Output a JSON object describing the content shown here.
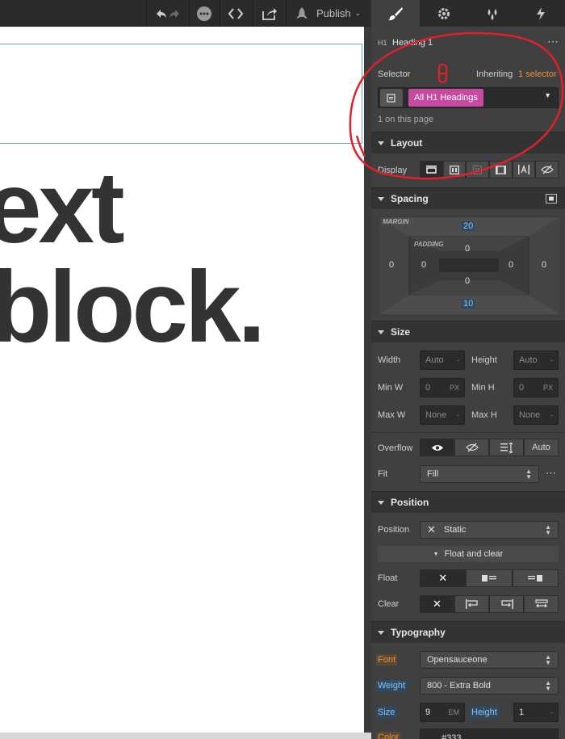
{
  "toolbar": {
    "publish_label": "Publish"
  },
  "canvas": {
    "line1": "ext",
    "line2": "block."
  },
  "panel_tabs": [
    "style",
    "settings",
    "interactions",
    "lightning"
  ],
  "element": {
    "tag": "H1",
    "name": "Heading 1"
  },
  "selector": {
    "label": "Selector",
    "inheriting_label": "Inheriting",
    "inheriting_link": "1 selector",
    "chip": "All H1 Headings",
    "count_note": "1 on this page"
  },
  "layout": {
    "title": "Layout",
    "display_label": "Display"
  },
  "spacing": {
    "title": "Spacing",
    "margin_label": "MARGIN",
    "padding_label": "PADDING",
    "margin_top": "20",
    "margin_bottom": "10",
    "margin_left": "0",
    "margin_right": "0",
    "padding_top": "0",
    "padding_bottom": "0",
    "padding_left": "0",
    "padding_right": "0"
  },
  "size": {
    "title": "Size",
    "width_label": "Width",
    "width_value": "Auto",
    "height_label": "Height",
    "height_value": "Auto",
    "minw_label": "Min W",
    "minw_value": "0",
    "minw_unit": "PX",
    "minh_label": "Min H",
    "minh_value": "0",
    "minh_unit": "PX",
    "maxw_label": "Max W",
    "maxw_value": "None",
    "maxh_label": "Max H",
    "maxh_value": "None",
    "dash": "-",
    "overflow_label": "Overflow",
    "overflow_auto": "Auto",
    "fit_label": "Fit",
    "fit_value": "Fill"
  },
  "position": {
    "title": "Position",
    "position_label": "Position",
    "position_value": "Static",
    "float_clear_toggle": "Float and clear",
    "float_label": "Float",
    "clear_label": "Clear"
  },
  "typography": {
    "title": "Typography",
    "font_label": "Font",
    "font_value": "Opensauceone",
    "weight_label": "Weight",
    "weight_value": "800 - Extra Bold",
    "size_label": "Size",
    "size_value": "9",
    "size_unit": "EM",
    "height_label": "Height",
    "height_value": "1",
    "color_label": "Color",
    "color_value": "#333"
  },
  "colors": {
    "accent_pink": "#c54aa0",
    "link_orange": "#e8913c",
    "annotation_red": "#e0202a",
    "selection_blue": "#5fa3c8"
  }
}
